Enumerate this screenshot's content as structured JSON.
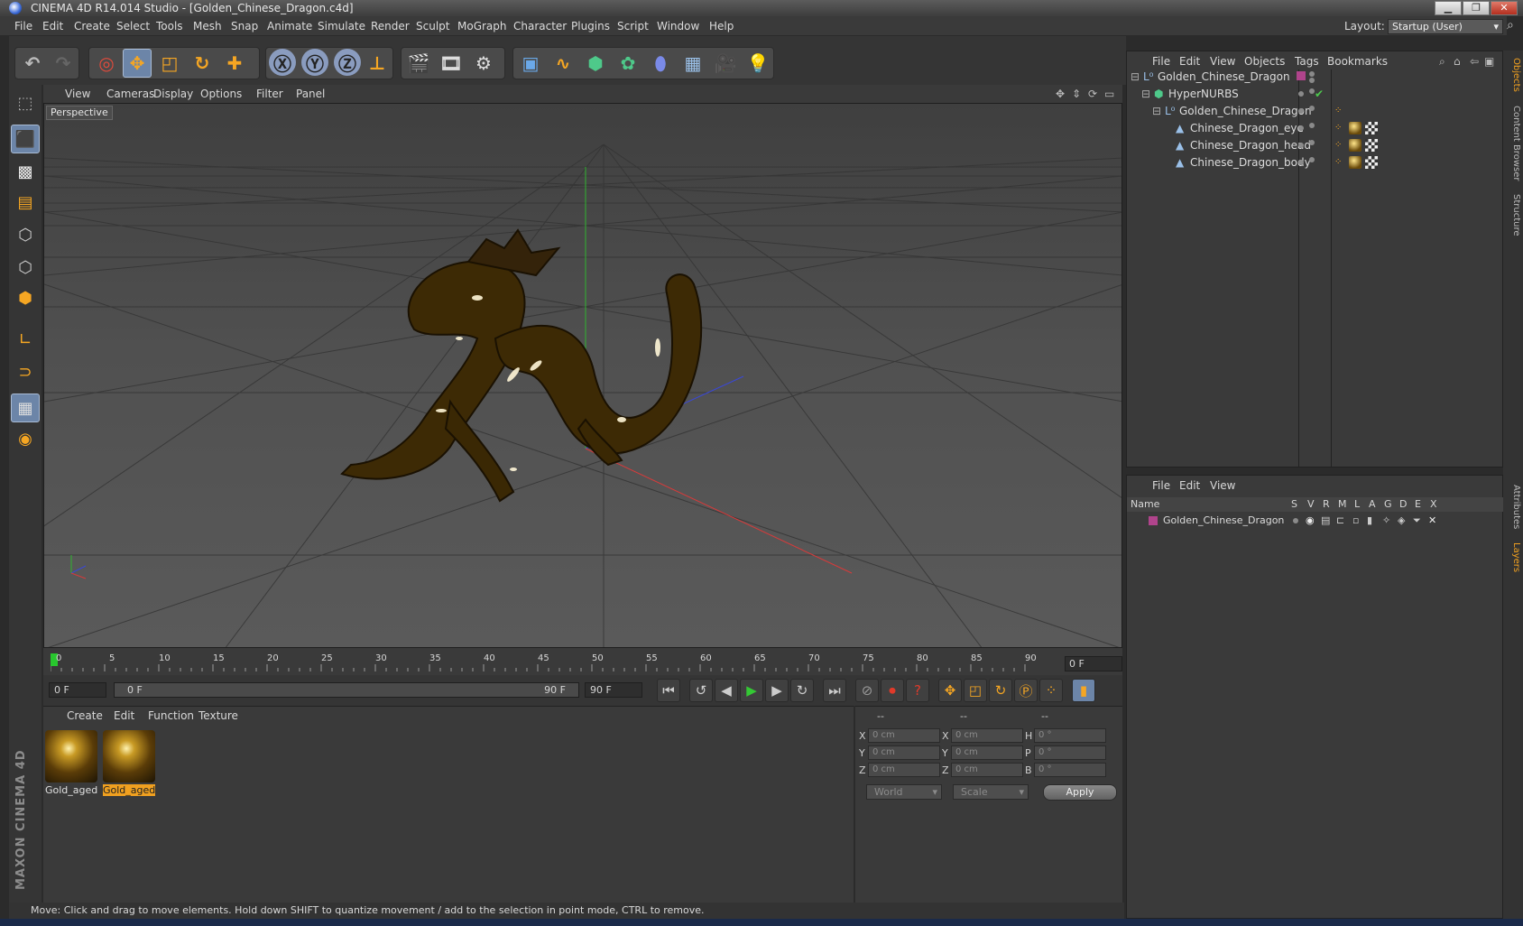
{
  "window": {
    "title": "CINEMA 4D R14.014 Studio - [Golden_Chinese_Dragon.c4d]"
  },
  "menu": [
    "File",
    "Edit",
    "Create",
    "Select",
    "Tools",
    "Mesh",
    "Snap",
    "Animate",
    "Simulate",
    "Render",
    "Sculpt",
    "MoGraph",
    "Character",
    "Plugins",
    "Script",
    "Window",
    "Help"
  ],
  "layout": {
    "label": "Layout:",
    "value": "Startup (User)"
  },
  "viewport": {
    "menu": [
      "View",
      "Cameras",
      "Display",
      "Options",
      "Filter",
      "Panel"
    ],
    "camera_label": "Perspective"
  },
  "timeline": {
    "ticks": [
      "0",
      "5",
      "10",
      "15",
      "20",
      "25",
      "30",
      "35",
      "40",
      "45",
      "50",
      "55",
      "60",
      "65",
      "70",
      "75",
      "80",
      "85",
      "90"
    ],
    "current_frame": "0 F",
    "start_frame": "0 F",
    "range_start": "0 F",
    "range_end": "90 F",
    "end_frame": "90 F"
  },
  "material_panel": {
    "menu": [
      "Create",
      "Edit",
      "Function",
      "Texture"
    ],
    "materials": [
      {
        "name": "Gold_aged",
        "selected": false
      },
      {
        "name": "Gold_aged",
        "selected": true
      }
    ]
  },
  "coords": {
    "headers": [
      "--",
      "--",
      "--"
    ],
    "rows": [
      {
        "a": "X",
        "av": "0 cm",
        "b": "X",
        "bv": "0 cm",
        "c": "H",
        "cv": "0 °"
      },
      {
        "a": "Y",
        "av": "0 cm",
        "b": "Y",
        "bv": "0 cm",
        "c": "P",
        "cv": "0 °"
      },
      {
        "a": "Z",
        "av": "0 cm",
        "b": "Z",
        "bv": "0 cm",
        "c": "B",
        "cv": "0 °"
      }
    ],
    "mode1": "World",
    "mode2": "Scale",
    "apply": "Apply"
  },
  "status": "Move: Click and drag to move elements. Hold down SHIFT to quantize movement / add to the selection in point mode, CTRL to remove.",
  "objects_panel": {
    "menu": [
      "File",
      "Edit",
      "View",
      "Objects",
      "Tags",
      "Bookmarks"
    ],
    "items": [
      {
        "name": "Golden_Chinese_Dragon",
        "icon": "null-icon",
        "indent": 0
      },
      {
        "name": "HyperNURBS",
        "icon": "hypernurbs-icon",
        "indent": 1
      },
      {
        "name": "Golden_Chinese_Dragon",
        "icon": "null-icon",
        "indent": 2
      },
      {
        "name": "Chinese_Dragon_eye",
        "icon": "polygon-object-icon",
        "indent": 3
      },
      {
        "name": "Chinese_Dragon_head",
        "icon": "polygon-object-icon",
        "indent": 3
      },
      {
        "name": "Chinese_Dragon_body",
        "icon": "polygon-object-icon",
        "indent": 3
      }
    ]
  },
  "layers_panel": {
    "menu": [
      "File",
      "Edit",
      "View"
    ],
    "columns": [
      "Name",
      "S",
      "V",
      "R",
      "M",
      "L",
      "A",
      "G",
      "D",
      "E",
      "X"
    ],
    "layers": [
      {
        "name": "Golden_Chinese_Dragon",
        "color": "#b0448c"
      }
    ]
  },
  "right_tabs": [
    "Objects",
    "Content Browser",
    "Structure",
    "Attributes",
    "Layers"
  ],
  "logo": {
    "line1": "MAXON",
    "line2": "CINEMA 4D"
  }
}
